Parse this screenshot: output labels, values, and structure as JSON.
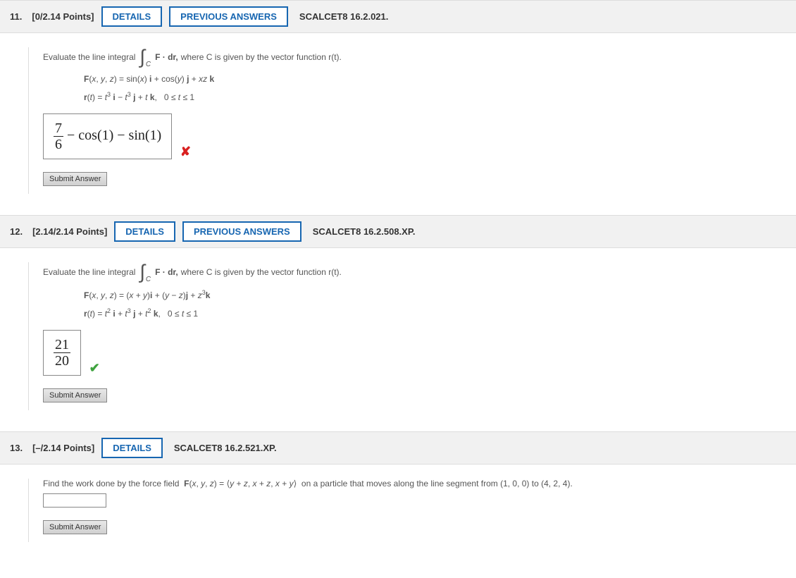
{
  "buttons": {
    "details": "DETAILS",
    "previous": "PREVIOUS ANSWERS",
    "submit": "Submit Answer"
  },
  "q11": {
    "num": "11.",
    "points": "[0/2.14 Points]",
    "source": "SCALCET8 16.2.021.",
    "prompt_a": "Evaluate the line integral",
    "prompt_b": "F · dr,",
    "prompt_c": "where C is given by the vector function r(t).",
    "F_line": "F(x, y, z) = sin(x) i + cos(y) j + xz k",
    "r_line": "r(t) = t³ i − t³ j + t k,   0 ≤ t ≤ 1",
    "ans_frac_num": "7",
    "ans_frac_den": "6",
    "ans_rest": " − cos(1) − sin(1)",
    "mark": "✘"
  },
  "q12": {
    "num": "12.",
    "points": "[2.14/2.14 Points]",
    "source": "SCALCET8 16.2.508.XP.",
    "prompt_a": "Evaluate the line integral",
    "prompt_b": "F · dr,",
    "prompt_c": "where C is given by the vector function r(t).",
    "F_line": "F(x, y, z) = (x + y)i + (y − z)j + z³k",
    "r_line": "r(t) = t² i + t³ j + t² k,   0 ≤ t ≤ 1",
    "ans_frac_num": "21",
    "ans_frac_den": "20",
    "mark": "✔"
  },
  "q13": {
    "num": "13.",
    "points": "[–/2.14 Points]",
    "source": "SCALCET8 16.2.521.XP.",
    "prompt_a": "Find the work done by the force field  F(x, y, z) = ⟨y + z, x + z, x + y⟩  on a particle that moves along the line segment from (1, 0, 0) to (4, 2, 4)."
  }
}
